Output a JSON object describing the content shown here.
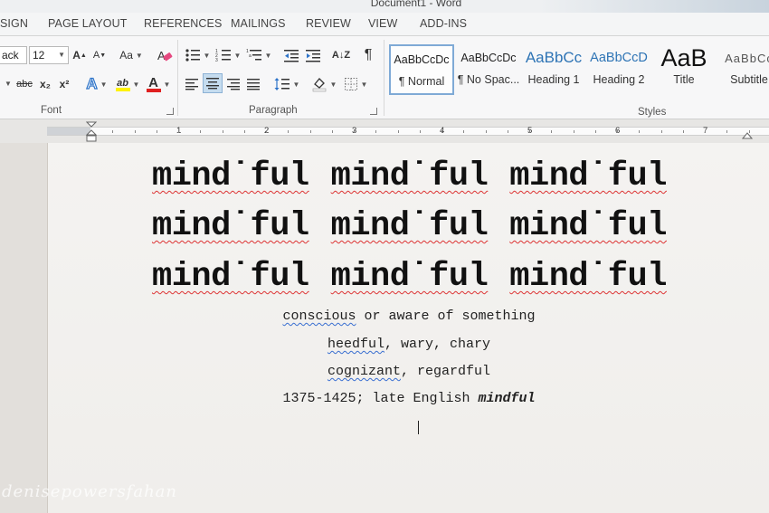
{
  "window": {
    "title": "Document1 - Word"
  },
  "tabs": [
    "SIGN",
    "PAGE LAYOUT",
    "REFERENCES",
    "MAILINGS",
    "REVIEW",
    "VIEW",
    "ADD-INS"
  ],
  "font_group": {
    "label": "Font",
    "font_name": "ack",
    "font_size": "12",
    "grow": "A",
    "shrink": "A",
    "change_case": "Aa",
    "strike": "abc",
    "subscript": "x₂",
    "superscript": "x²",
    "text_effects": "A",
    "highlight": "ab",
    "font_color": "A"
  },
  "paragraph_group": {
    "label": "Paragraph",
    "sort": "A↓Z",
    "pilcrow": "¶"
  },
  "styles_group": {
    "label": "Styles",
    "items": [
      {
        "sample": "AaBbCcDc",
        "name": "¶ Normal"
      },
      {
        "sample": "AaBbCcDc",
        "name": "¶ No Spac..."
      },
      {
        "sample": "AaBbCc",
        "name": "Heading 1"
      },
      {
        "sample": "AaBbCcD",
        "name": "Heading 2"
      },
      {
        "sample": "AaB",
        "name": "Title"
      },
      {
        "sample": "AaBbCc",
        "name": "Subtitle"
      }
    ]
  },
  "ruler": {
    "numbers": [
      "1",
      "2",
      "3",
      "4",
      "5",
      "6",
      "7"
    ]
  },
  "document": {
    "headline_word": "mind˙ful",
    "rows": [
      [
        "mind˙ful",
        "mind˙ful",
        "mind˙ful"
      ],
      [
        "mind˙ful",
        "mind˙ful",
        "mind˙ful"
      ],
      [
        "mind˙ful",
        "mind˙ful",
        "mind˙ful"
      ]
    ],
    "def1_word": "conscious",
    "def1_rest": " or aware of something",
    "def2_word": "heedful",
    "def2_rest": ", wary, chary",
    "def3_word": "cognizant",
    "def3_rest": ", regardful",
    "etym_prefix": "1375-1425; late English ",
    "etym_word": "mindful"
  },
  "watermark": "denisepowersfahan"
}
